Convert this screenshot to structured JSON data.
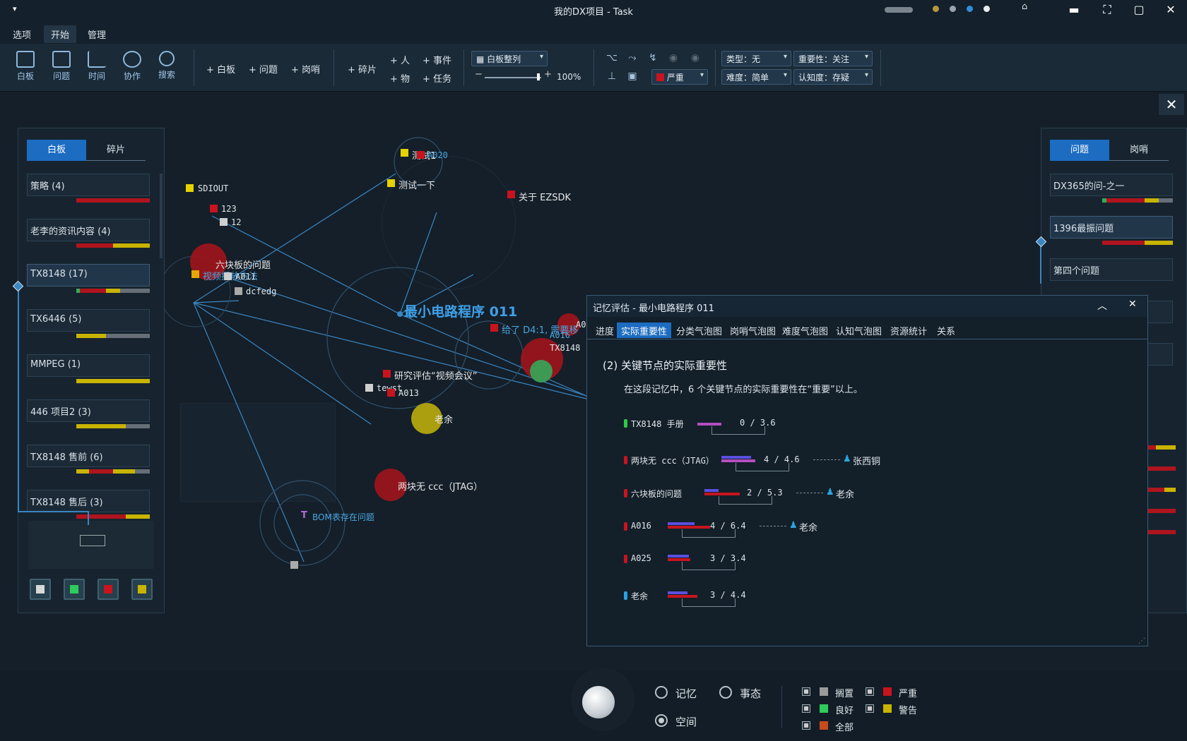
{
  "window": {
    "title": "我的DX项目 - Task"
  },
  "menu": [
    "选项",
    "开始",
    "管理"
  ],
  "ribbon": {
    "nav": [
      "白板",
      "问题",
      "时间",
      "协作",
      "搜索"
    ],
    "add1": [
      "+ 白板",
      "+ 问题",
      "+ 岗哨"
    ],
    "add2": [
      "+ 碎片",
      "+ 人",
      "+ 物",
      "+ 事件",
      "+ 任务"
    ],
    "arrange": "白板整列",
    "zoom": "100%",
    "severity": "严重",
    "type": "类型：无",
    "importance": "重要性：关注",
    "difficulty": "难度：简单",
    "cognition": "认知度：存疑"
  },
  "left_panel": {
    "tabs": [
      "白板",
      "碎片"
    ],
    "boards": [
      {
        "label": "策略 (4)",
        "bar": [
          [
            "#b0141e",
            1.0
          ]
        ]
      },
      {
        "label": "老李的资讯内容 (4)",
        "bar": [
          [
            "#b0141e",
            0.5
          ],
          [
            "#c8b400",
            0.5
          ]
        ]
      },
      {
        "label": "TX8148 (17)",
        "bar": [
          [
            "#2fae5a",
            0.05
          ],
          [
            "#b0141e",
            0.35
          ],
          [
            "#c8b400",
            0.2
          ],
          [
            "#666f78",
            0.4
          ]
        ]
      },
      {
        "label": "TX6446 (5)",
        "bar": [
          [
            "#c8b400",
            0.4
          ],
          [
            "#666f78",
            0.6
          ]
        ]
      },
      {
        "label": "MMPEG (1)",
        "bar": [
          [
            "#c8b400",
            1.0
          ]
        ]
      },
      {
        "label": "446 项目2 (3)",
        "bar": [
          [
            "#c8b400",
            0.67
          ],
          [
            "#666f78",
            0.33
          ]
        ]
      },
      {
        "label": "TX8148 售前 (6)",
        "bar": [
          [
            "#c8b400",
            0.17
          ],
          [
            "#b0141e",
            0.33
          ],
          [
            "#c8b400",
            0.3
          ],
          [
            "#666f78",
            0.2
          ]
        ]
      },
      {
        "label": "TX8148 售后 (3)",
        "bar": [
          [
            "#b0141e",
            0.67
          ],
          [
            "#c8b400",
            0.33
          ]
        ]
      }
    ]
  },
  "right_panel": {
    "tabs": [
      "问题",
      "岗哨"
    ],
    "issues": [
      "DX365的问-之一",
      "1396最振问题",
      "第四个问题"
    ]
  },
  "graph": {
    "center_title": "最小电路程序 011",
    "labels": {
      "sdiout": "SDIOUT",
      "n123": "123",
      "n12": "12",
      "test1": "测试1",
      "a020": "A020",
      "test_once": "测试一下",
      "ezsdk": "关于 EZSDK",
      "six": "六块板的问题",
      "video": "视频播放方法",
      "a011": "A011",
      "dcfedg": "dcfedg",
      "given": "给了 D4:1, 需要移",
      "a016": "A016",
      "tx8148": "TX8148",
      "a0": "A0",
      "research": "研究评估“视频会议”",
      "tewst": "tewst",
      "a013": "A013",
      "laoyu": "老余",
      "liangkuai": "两块无 ccc（JTAG）",
      "bom": "BOM表存在问题",
      "t": "T"
    }
  },
  "dialog": {
    "title": "记忆评估 - 最小电路程序 011",
    "tabs": [
      "进度",
      "实际重要性",
      "分类气泡图",
      "岗哨气泡图",
      "难度气泡图",
      "认知气泡图",
      "资源统计",
      "关系"
    ],
    "heading": "(2) 关键节点的实际重要性",
    "summary": "在这段记忆中，6 个关键节点的实际重要性在“重要”以上。",
    "rows": [
      {
        "name": "TX8148 手册",
        "color": "#2ecc40",
        "score": "0 / 3.6",
        "person": ""
      },
      {
        "name": "两块无 ccc（JTAG）",
        "color": "#c8141e",
        "score": "4 / 4.6",
        "person": "张西铜"
      },
      {
        "name": "六块板的问题",
        "color": "#c8141e",
        "score": "2 / 5.3",
        "person": "老余"
      },
      {
        "name": "A016",
        "color": "#c8141e",
        "score": "4 / 6.4",
        "person": "老余"
      },
      {
        "name": "A025",
        "color": "#c8141e",
        "score": "3 / 3.4",
        "person": ""
      },
      {
        "name": "老余",
        "color": "#2aa3e0",
        "score": "3 / 4.4",
        "person": ""
      }
    ]
  },
  "bottom": {
    "radios": [
      "记忆",
      "事态",
      "空间"
    ],
    "legend": [
      {
        "label": "搁置",
        "color": "#9a9a9a"
      },
      {
        "label": "严重",
        "color": "#c8141e"
      },
      {
        "label": "良好",
        "color": "#2ecc5a"
      },
      {
        "label": "警告",
        "color": "#c8b400"
      },
      {
        "label": "全部",
        "color": "#c84a1e"
      }
    ]
  }
}
